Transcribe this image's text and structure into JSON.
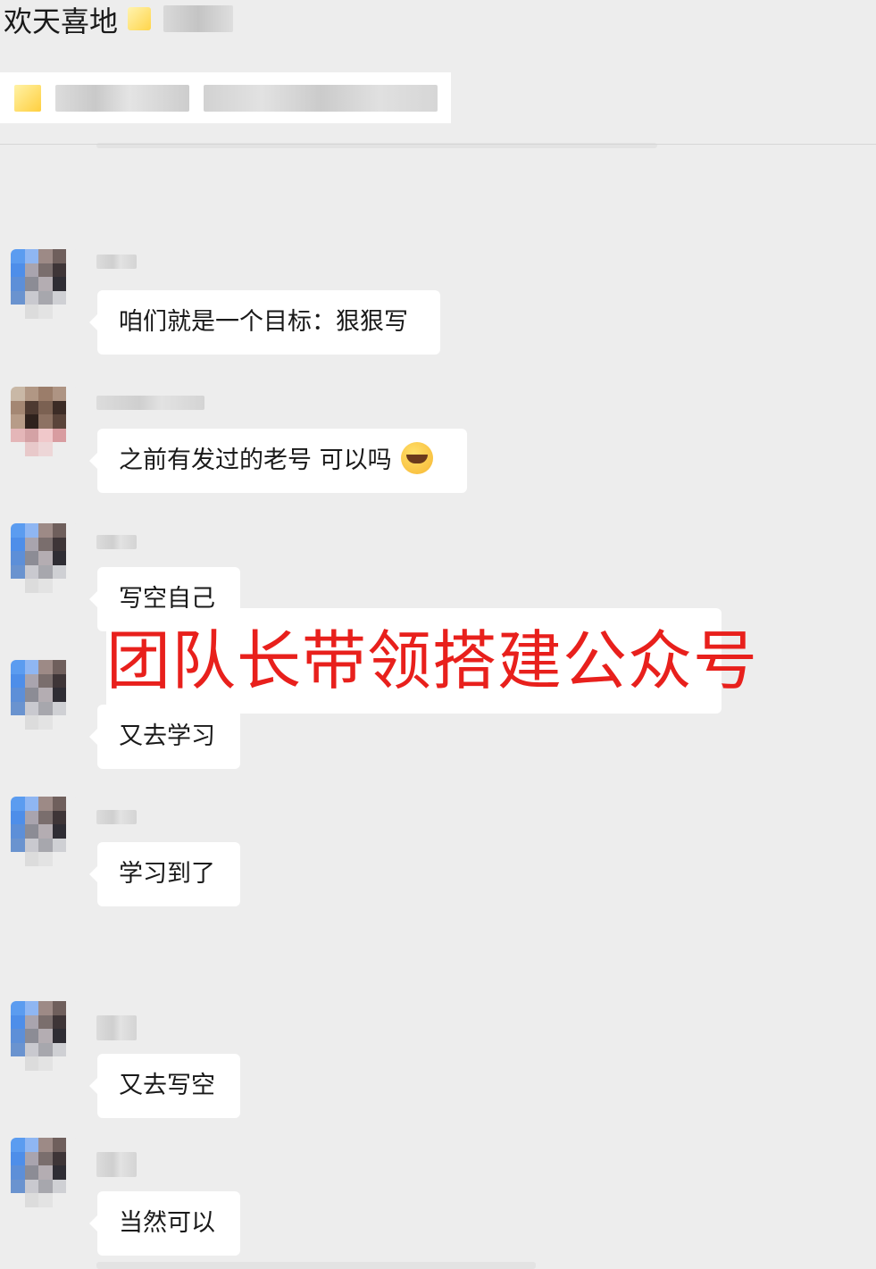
{
  "header": {
    "group_name": "欢天喜地"
  },
  "quote": {
    "text": ""
  },
  "messages": [
    {
      "text": "咱们就是一个目标：狠狠写"
    },
    {
      "text": "之前有发过的老号 可以吗",
      "emoji": "crying-laughing-emoji"
    },
    {
      "text": "写空自己"
    },
    {
      "text": "又去学习"
    },
    {
      "text": "学习到了"
    },
    {
      "text": "又去写空"
    },
    {
      "text": "当然可以"
    }
  ],
  "overlay": {
    "caption": "团队长带领搭建公众号"
  },
  "colors": {
    "background": "#ededed",
    "bubble": "#ffffff",
    "overlay_text": "#e8201c"
  }
}
